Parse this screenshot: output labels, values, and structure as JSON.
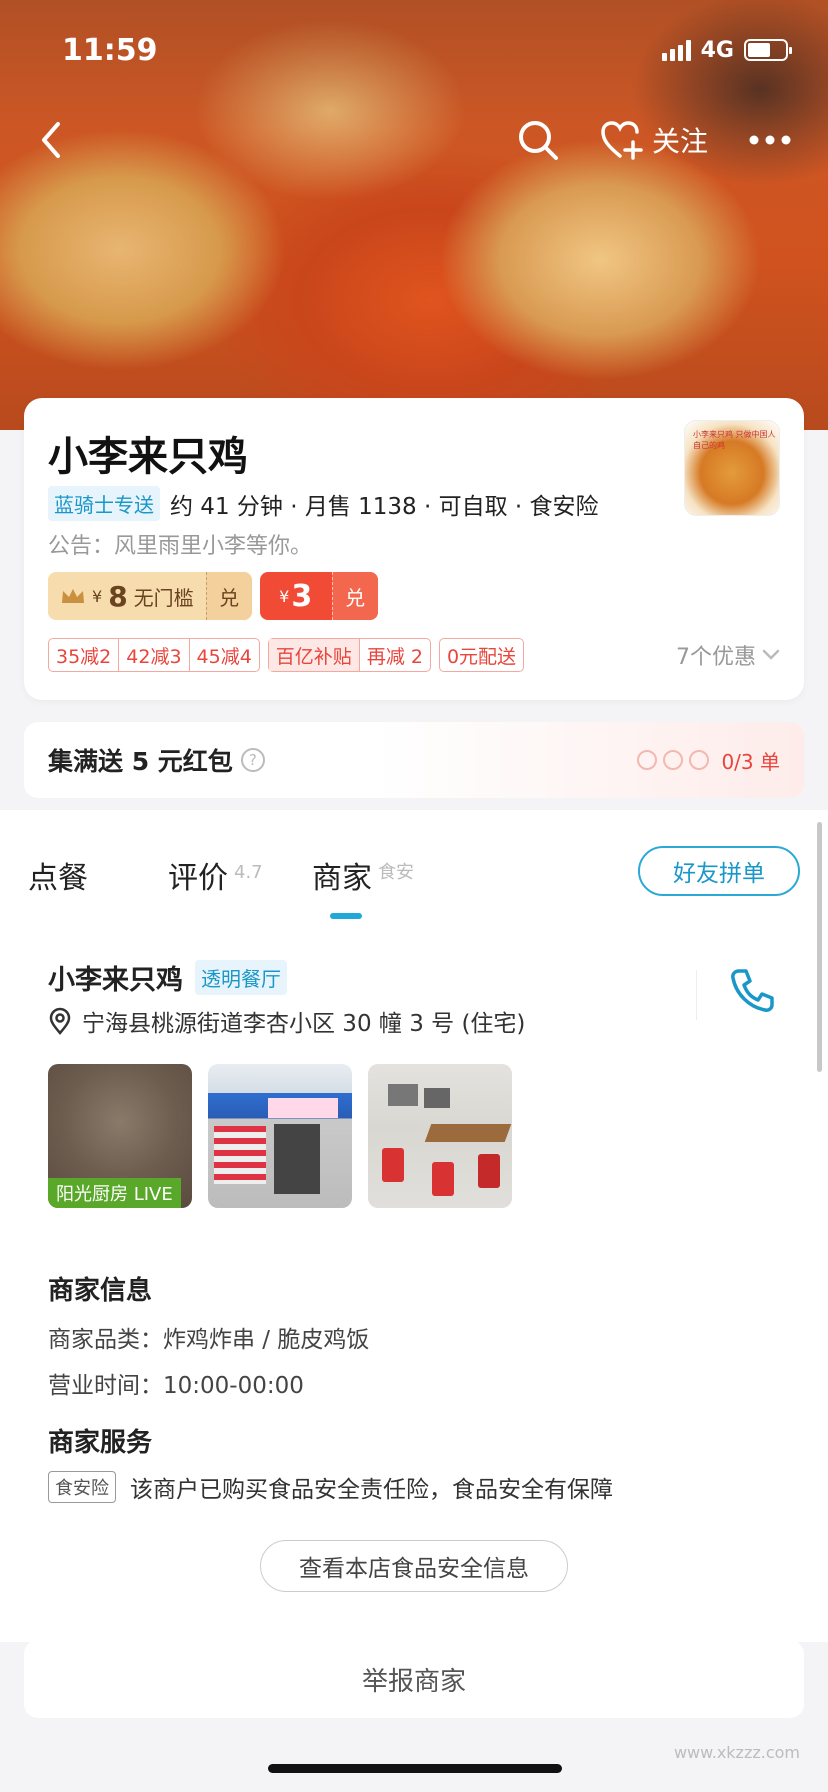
{
  "status_bar": {
    "time": "11:59",
    "network": "4G"
  },
  "nav": {
    "follow_label": "关注"
  },
  "shop": {
    "name": "小李来只鸡",
    "delivery_tag": "蓝骑士专送",
    "meta": "约 41 分钟 · 月售 1138 · 可自取 · 食安险",
    "notice": "公告：风里雨里小李等你。",
    "logo_text": "小李来只鸡 只做中国人自己的鸡"
  },
  "coupons": {
    "gold": {
      "currency": "¥",
      "amount": "8",
      "desc": "无门槛",
      "action": "兑"
    },
    "red": {
      "currency": "¥",
      "amount": "3",
      "action": "兑"
    }
  },
  "promos": {
    "discounts": [
      "35减2",
      "42减3",
      "45减4"
    ],
    "subsidy": [
      "百亿补贴",
      "再减 2"
    ],
    "free_delivery": "0元配送",
    "more": "7个优惠"
  },
  "collect": {
    "title": "集满送 5 元红包",
    "help": "?",
    "progress": "0/3 单"
  },
  "tabs": {
    "order": "点餐",
    "review": "评价",
    "review_score": "4.7",
    "merchant": "商家",
    "merchant_sub": "食安",
    "group_order": "好友拼单"
  },
  "merchant": {
    "name": "小李来只鸡",
    "badge": "透明餐厅",
    "address": "宁海县桃源街道李杏小区 30 幢 3 号 (住宅)",
    "live_label": "阳光厨房 LIVE",
    "info_title": "商家信息",
    "category": "商家品类：炸鸡炸串 / 脆皮鸡饭",
    "hours": "营业时间：10:00-00:00",
    "service_title": "商家服务",
    "service_tag": "食安险",
    "service_desc": "该商户已购买食品安全责任险，食品安全有保障",
    "safety_button": "查看本店食品安全信息"
  },
  "report": "举报商家",
  "watermark": "www.xkzzz.com",
  "colors": {
    "accent": "#20a9d8",
    "red": "#f24b35",
    "gold": "#f7dcae"
  }
}
